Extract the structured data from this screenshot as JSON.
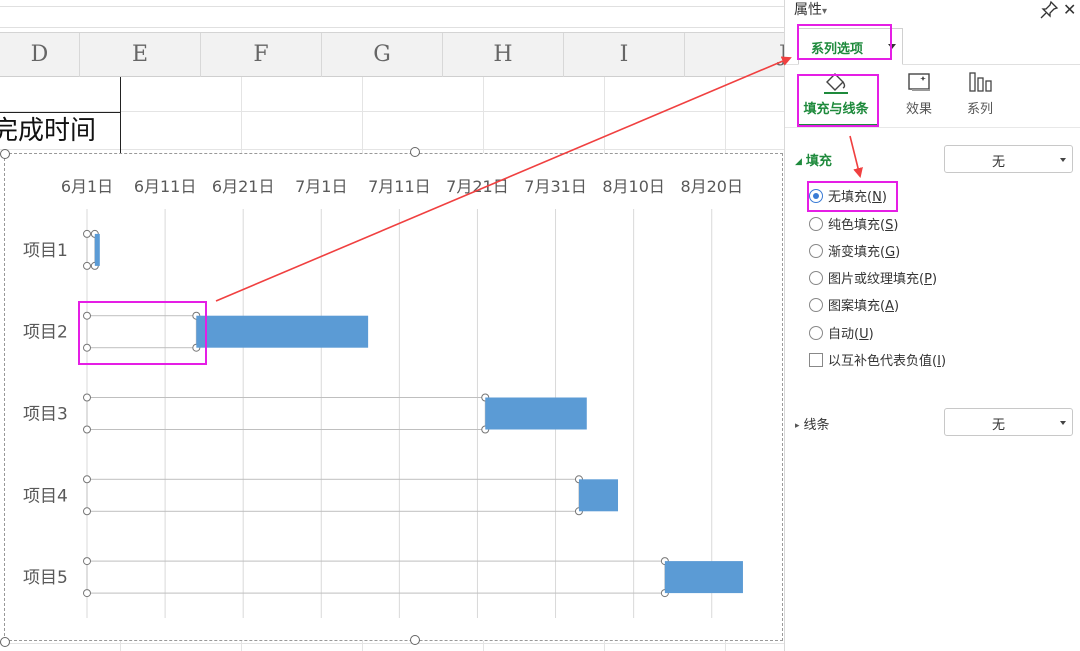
{
  "sheet": {
    "columns": [
      "D",
      "E",
      "F",
      "G",
      "H",
      "I",
      "J"
    ],
    "cell_text": "完成时间"
  },
  "chart_data": {
    "type": "bar",
    "orientation": "horizontal",
    "stacked": true,
    "x_tick_labels": [
      "6月1日",
      "6月11日",
      "6月21日",
      "7月1日",
      "7月11日",
      "7月21日",
      "7月31日",
      "8月10日",
      "8月20日"
    ],
    "x_ticks": [
      "2024-06-01",
      "2024-06-11",
      "2024-06-21",
      "2024-07-01",
      "2024-07-11",
      "2024-07-21",
      "2024-07-31",
      "2024-08-10",
      "2024-08-20"
    ],
    "xlim": [
      "2024-06-01",
      "2024-08-29"
    ],
    "categories": [
      "项目1",
      "项目2",
      "项目3",
      "项目4",
      "项目5"
    ],
    "series": [
      {
        "values_start": [
          "2024-06-01",
          "2024-06-01",
          "2024-06-01",
          "2024-06-01",
          "2024-06-01"
        ],
        "values_end": [
          "2024-06-02",
          "2024-06-15",
          "2024-07-22",
          "2024-08-03",
          "2024-08-14"
        ],
        "fill": "none",
        "outline": "#bfbfbf"
      },
      {
        "values_start": [
          "2024-06-02",
          "2024-06-15",
          "2024-07-22",
          "2024-08-03",
          "2024-08-14"
        ],
        "values_end": [
          "2024-06-02",
          "2024-07-07",
          "2024-08-04",
          "2024-08-08",
          "2024-08-24"
        ],
        "color": "#5b9bd5"
      }
    ],
    "grid": true,
    "legend": "none"
  },
  "panel": {
    "title": "属性",
    "title_caret": "▾",
    "close": "✕",
    "tab_label": "系列选项",
    "subtabs": [
      "填充与线条",
      "效果",
      "系列"
    ],
    "fill_section": "填充",
    "fill_value": "无",
    "options": [
      {
        "text": "无填充",
        "key": "N"
      },
      {
        "text": "纯色填充",
        "key": "S"
      },
      {
        "text": "渐变填充",
        "key": "G"
      },
      {
        "text": "图片或纹理填充",
        "key": "P"
      },
      {
        "text": "图案填充",
        "key": "A"
      },
      {
        "text": "自动",
        "key": "U"
      }
    ],
    "checkbox_text": "以互补色代表负值",
    "checkbox_key": "I",
    "line_section": "线条",
    "line_value": "无"
  },
  "colors": {
    "accent_green": "#1e8a3c",
    "highlight": "#e51ee5",
    "arrow": "#f04040",
    "bar": "#5b9bd5"
  }
}
